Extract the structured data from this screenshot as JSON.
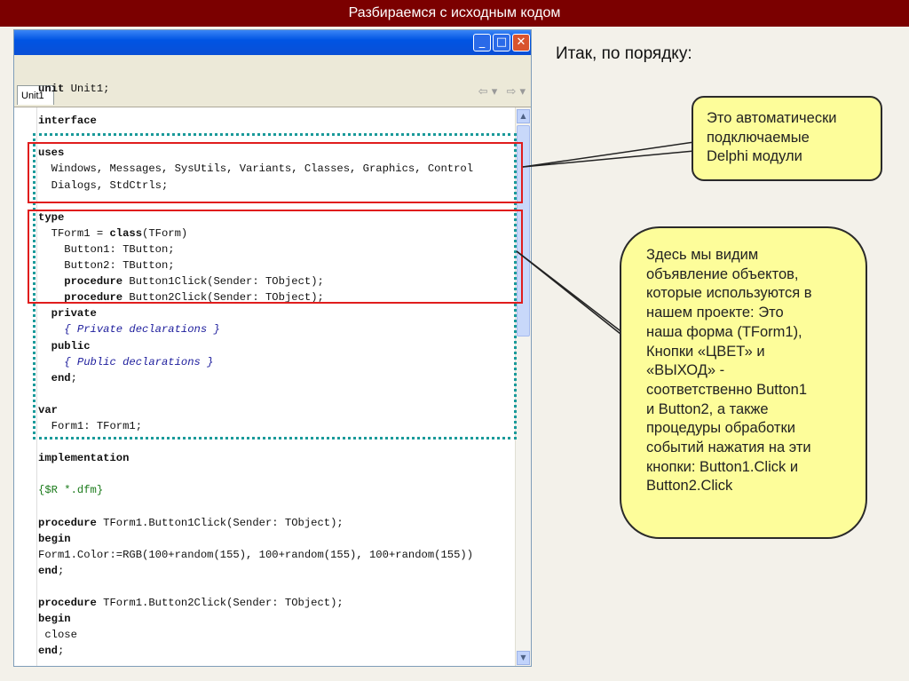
{
  "slide": {
    "title": "Разбираемся с исходным кодом",
    "intro": "Итак, по порядку:"
  },
  "editor": {
    "tab_label": "Unit1",
    "window_buttons": {
      "minimize": "_",
      "maximize": "□",
      "close": "✕"
    },
    "nav": {
      "back": "⇦ ▾",
      "forward": "⇨ ▾"
    },
    "lines": [
      "unit Unit1;",
      "",
      "interface",
      "",
      "uses",
      "  Windows, Messages, SysUtils, Variants, Classes, Graphics, Control",
      "  Dialogs, StdCtrls;",
      "",
      "type",
      "  TForm1 = class(TForm)",
      "    Button1: TButton;",
      "    Button2: TButton;",
      "    procedure Button1Click(Sender: TObject);",
      "    procedure Button2Click(Sender: TObject);",
      "  private",
      "    { Private declarations }",
      "  public",
      "    { Public declarations }",
      "  end;",
      "",
      "var",
      "  Form1: TForm1;",
      "",
      "implementation",
      "",
      "{$R *.dfm}",
      "",
      "procedure TForm1.Button1Click(Sender: TObject);",
      "begin",
      "Form1.Color:=RGB(100+random(155), 100+random(155), 100+random(155))",
      "end;",
      "",
      "procedure TForm1.Button2Click(Sender: TObject);",
      "begin",
      " close",
      "end;",
      ""
    ]
  },
  "callouts": {
    "units": "Это автоматически\nподключаемые\nDelphi модули",
    "objects": "Здесь мы видим\nобъявление объектов,\nкоторые используются в\nнашем проекте: Это\nнаша форма (TForm1),\nКнопки «ЦВЕТ» и\n«ВЫХОД» -\nсоответственно Button1\nи Button2, а также\nпроцедуры обработки\nсобытий нажатия на эти\nкнопки: Button1.Click и\nButton2.Click"
  },
  "colors": {
    "title_bar": "#7b0000",
    "callout_fill": "#fdfd9a",
    "highlight_red": "#e01d1d",
    "highlight_dotted": "#1a9a9a"
  }
}
